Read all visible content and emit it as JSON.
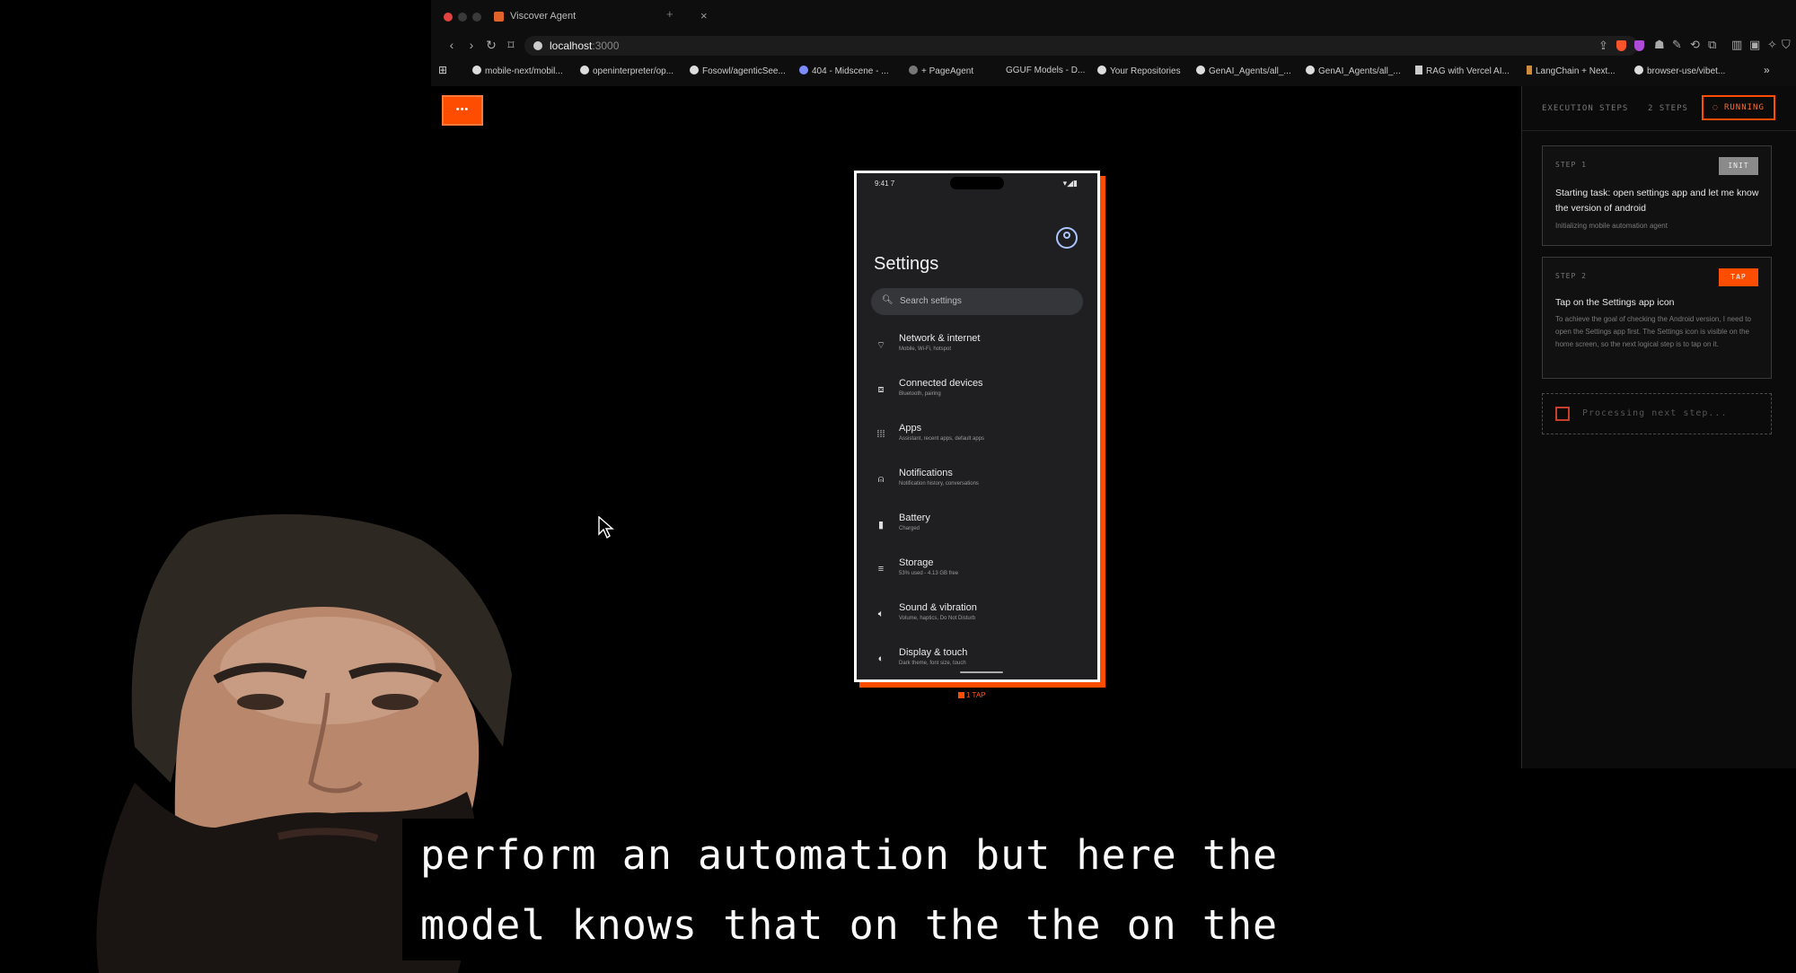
{
  "browser": {
    "tab_title": "Viscover Agent",
    "tab_close": "×",
    "new_tab": "+",
    "url_host": "localhost",
    "url_port": ":3000",
    "bookmarks": [
      "mobile-next/mobil...",
      "openinterpreter/op...",
      "Fosowl/agenticSee...",
      "404 - Midscene - ...",
      "+ PageAgent",
      "GGUF Models - D...",
      "Your Repositories",
      "GenAI_Agents/all_...",
      "GenAI_Agents/all_...",
      "RAG with Vercel AI...",
      "LangChain + Next...",
      "browser-use/vibet..."
    ],
    "bookmarks_more": "»"
  },
  "app": {
    "menu_label": "•••"
  },
  "phone": {
    "status_time": "9:41 7",
    "settings_title": "Settings",
    "search_placeholder": "Search settings",
    "items": [
      {
        "label": "Network & internet",
        "sub": "Mobile, Wi-Fi, hotspot",
        "icon": "wifi-icon"
      },
      {
        "label": "Connected devices",
        "sub": "Bluetooth, pairing",
        "icon": "devices-icon"
      },
      {
        "label": "Apps",
        "sub": "Assistant, recent apps, default apps",
        "icon": "apps-grid-icon"
      },
      {
        "label": "Notifications",
        "sub": "Notification history, conversations",
        "icon": "bell-icon"
      },
      {
        "label": "Battery",
        "sub": "Charged",
        "icon": "battery-icon"
      },
      {
        "label": "Storage",
        "sub": "53% used - 4.13 GB free",
        "icon": "storage-icon"
      },
      {
        "label": "Sound & vibration",
        "sub": "Volume, haptics, Do Not Disturb",
        "icon": "speaker-icon"
      },
      {
        "label": "Display & touch",
        "sub": "Dark theme, font size, touch",
        "icon": "display-icon"
      }
    ],
    "tap_label": "1 TAP"
  },
  "panel": {
    "title": "EXECUTION STEPS",
    "count": "2 STEPS",
    "status": "RUNNING",
    "steps": [
      {
        "num": "STEP 1",
        "badge": "INIT",
        "heading": "Starting task: open settings app and let me know the version of android",
        "description": "Initializing mobile automation agent"
      },
      {
        "num": "STEP 2",
        "badge": "TAP",
        "heading": "Tap on the Settings app icon",
        "description": "To achieve the goal of checking the Android version, I need to open the Settings app first. The Settings icon is visible on the home screen, so the next logical step is to tap on it."
      }
    ],
    "processing": "Processing next step..."
  },
  "captions": {
    "line1": "perform an automation but here the",
    "line2": "model knows that on the the on the"
  },
  "colors": {
    "accent": "#ff4d00",
    "background": "#000000",
    "panel_bg": "#0b0b0b",
    "init_badge": "#8a8a8a"
  }
}
